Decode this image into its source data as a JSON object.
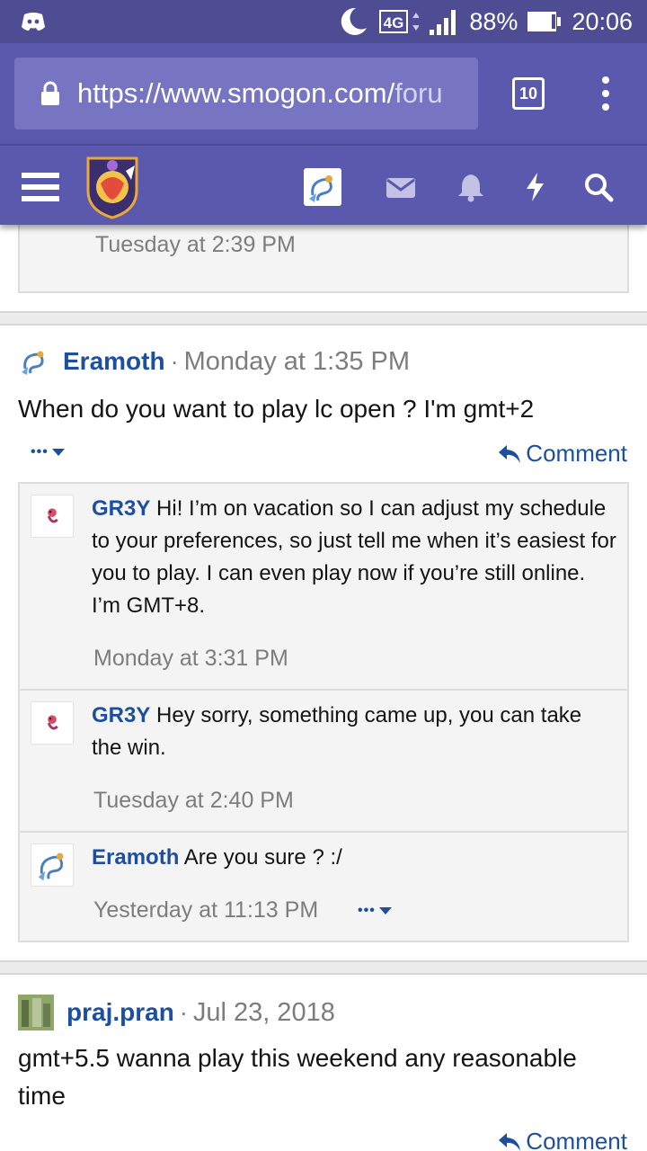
{
  "status_bar": {
    "network": "4G",
    "battery": "88%",
    "time": "20:06"
  },
  "browser": {
    "url_main": "https://www.smogon.com/",
    "url_faded": "foru",
    "tab_count": "10"
  },
  "prev_post": {
    "timestamp": "Tuesday at 2:39 PM"
  },
  "post1": {
    "username": "Eramoth",
    "separator": "·",
    "time": "Monday at 1:35 PM",
    "body": "When do you want to play lc open ? I'm gmt+2",
    "more": "•••",
    "comment_label": "Comment",
    "comments": [
      {
        "username": "GR3Y",
        "text": "Hi! I’m on vacation so I can adjust my schedule to your preferences, so just tell me when it’s easiest for you to play. I can even play now if you’re still online. I’m GMT+8.",
        "time": "Monday at 3:31 PM"
      },
      {
        "username": "GR3Y",
        "text": "Hey sorry, something came up, you can take the win.",
        "time": "Tuesday at 2:40 PM"
      },
      {
        "username": "Eramoth",
        "text": "Are you sure ? :/",
        "time": "Yesterday at 11:13 PM",
        "more": "•••"
      }
    ]
  },
  "post2": {
    "username": "praj.pran",
    "separator": "·",
    "time": "Jul 23, 2018",
    "body": "gmt+5.5 wanna play this weekend any reasonable time",
    "comment_label": "Comment"
  },
  "colors": {
    "status_bar": "#4e4c93",
    "toolbar": "#5b59ad",
    "link": "#1d4f9e",
    "muted": "#7d7d7d"
  }
}
